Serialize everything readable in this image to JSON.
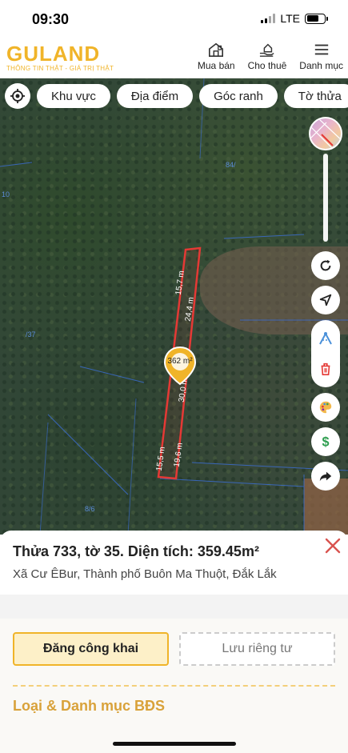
{
  "status": {
    "time": "09:30",
    "network": "LTE",
    "battery_level": 0.7
  },
  "header": {
    "logo": "GULAND",
    "tagline": "THÔNG TIN THẬT - GIÁ TRỊ THẬT",
    "nav": [
      {
        "label": "Mua bán",
        "icon": "house-icon"
      },
      {
        "label": "Cho thuê",
        "icon": "hand-house-icon"
      },
      {
        "label": "Danh mục",
        "icon": "menu-icon"
      }
    ]
  },
  "filters": [
    "Khu vực",
    "Địa điểm",
    "Góc ranh",
    "Tờ thửa"
  ],
  "map": {
    "labels": [
      "84/",
      "10",
      "/37",
      "8/6"
    ],
    "plot": {
      "area": "362 m²",
      "edges": [
        "15,7 m",
        "24,4 m",
        "30,0 m",
        "15,5 m",
        "19,6 m"
      ]
    }
  },
  "sheet": {
    "title": "Thửa 733, tờ 35. Diện tích: 359.45m²",
    "address": "Xã Cư ÊBur, Thành phố Buôn Ma Thuột, Đắk Lắk",
    "publish_label": "Đăng công khai",
    "private_label": "Lưu riêng tư",
    "category_label": "Loại & Danh mục BĐS"
  },
  "colors": {
    "brand": "#f0b429",
    "close": "#d9534f",
    "plot_outline": "#e53935"
  }
}
